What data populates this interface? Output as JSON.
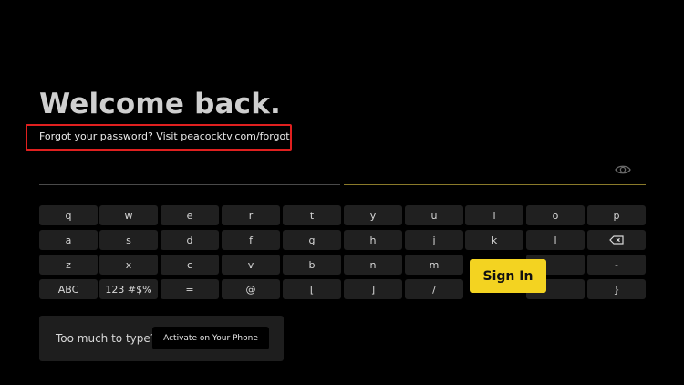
{
  "title": "Welcome back.",
  "forgot_password": "Forgot your password? Visit peacocktv.com/forgot",
  "password_field": {
    "visibility_toggle_icon": "eye-icon"
  },
  "keyboard": {
    "row1": [
      "q",
      "w",
      "e",
      "r",
      "t",
      "y",
      "u",
      "i",
      "o",
      "p"
    ],
    "row2": [
      "a",
      "s",
      "d",
      "f",
      "g",
      "h",
      "j",
      "k",
      "l"
    ],
    "row2_backspace_icon": "backspace-icon",
    "row3": [
      "z",
      "x",
      "c",
      "v",
      "b",
      "n",
      "m",
      "",
      "",
      "-"
    ],
    "row4": [
      "ABC",
      "123 #$%",
      "=",
      "@",
      "[",
      "]",
      "/",
      "",
      "",
      "}"
    ],
    "signin_label": "Sign In"
  },
  "activate": {
    "label": "Too much to type?",
    "button": "Activate on Your Phone"
  },
  "colors": {
    "accent": "#f3d321",
    "highlight_border": "#e0201f",
    "key_background": "#202020"
  }
}
